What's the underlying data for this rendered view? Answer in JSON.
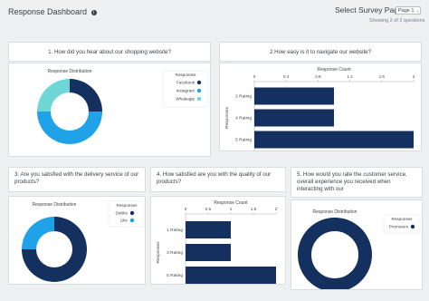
{
  "header": {
    "title": "Response Dashboard",
    "info_icon": "i",
    "select_label": "Select Survey Page",
    "page_select_value": "Page 1",
    "showing_text": "Showing 2 of 2 questions"
  },
  "colors": {
    "navy": "#14305e",
    "blue": "#1fa2e8",
    "teal": "#6fd8d6"
  },
  "questions": [
    {
      "label": "1. How did you hear about our shopping website?"
    },
    {
      "label": "2.How easy is it to navigate our website?"
    },
    {
      "label": "3. Are you satisfied with the delivery service of our products?"
    },
    {
      "label": "4. How satisfied are you with the quality of our products?"
    },
    {
      "label": "5. How would you rate the customer service, overall experience you received when interacting with our"
    }
  ],
  "chart_data": [
    {
      "type": "pie",
      "title": "Response Distribution",
      "legend_title": "Responses",
      "legend_position": "right",
      "categories": [
        "Facebook",
        "Instagram",
        "Whatsapp"
      ],
      "values": [
        1,
        2,
        1
      ],
      "colors": [
        "#14305e",
        "#1fa2e8",
        "#6fd8d6"
      ]
    },
    {
      "type": "bar",
      "orientation": "horizontal",
      "title": "Response Count",
      "ylabel": "Responses",
      "categories": [
        "2 Rating",
        "4 Rating",
        "5 Rating"
      ],
      "values": [
        1,
        1,
        2
      ],
      "xlim": [
        0,
        2
      ],
      "ticks": [
        "0",
        "0.4",
        "0.8",
        "1.2",
        "1.6",
        "2"
      ],
      "color": "#14305e"
    },
    {
      "type": "pie",
      "title": "Response Distribution",
      "legend_title": "Responses",
      "legend_position": "right",
      "categories": [
        "Dislike",
        "Like"
      ],
      "values": [
        3,
        1
      ],
      "colors": [
        "#14305e",
        "#1fa2e8"
      ]
    },
    {
      "type": "bar",
      "orientation": "horizontal",
      "title": "Response Count",
      "ylabel": "Responses",
      "categories": [
        "1 Rating",
        "3 Rating",
        "5 Rating"
      ],
      "values": [
        1,
        1,
        2
      ],
      "xlim": [
        0,
        2
      ],
      "ticks": [
        "0",
        "0.5",
        "1",
        "1.5",
        "2"
      ],
      "color": "#14305e"
    },
    {
      "type": "pie",
      "title": "Response Distribution",
      "legend_title": "Responses",
      "legend_position": "right",
      "categories": [
        "Promoters"
      ],
      "values": [
        1
      ],
      "colors": [
        "#14305e"
      ]
    }
  ]
}
